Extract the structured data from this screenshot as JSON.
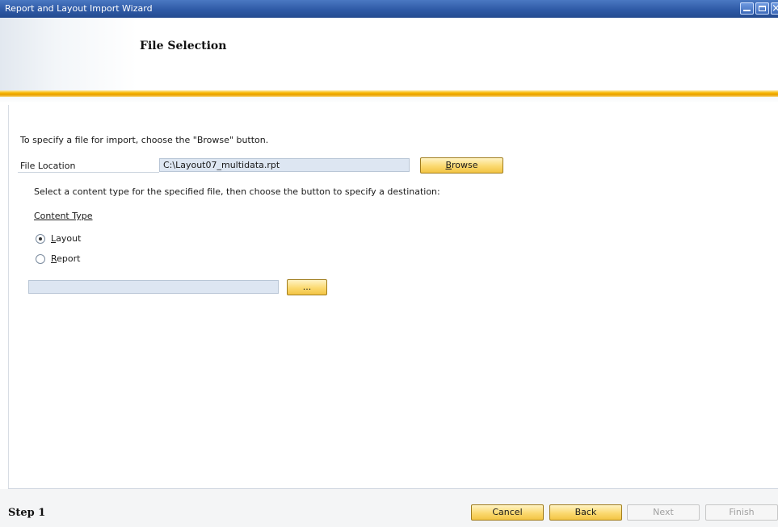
{
  "window": {
    "title": "Report and Layout Import Wizard"
  },
  "header": {
    "page_title": "File Selection"
  },
  "content": {
    "instruction": "To specify a file for import, choose the \"Browse\" button.",
    "file_location_label": "File Location",
    "file_location_value": "C:\\Layout07_multidata.rpt",
    "browse_accel": "B",
    "browse_rest": "rowse",
    "select_instruction": "Select a content type for the specified file, then choose the button to specify a destination:",
    "content_type_label": "Content Type",
    "options": [
      {
        "accel": "L",
        "rest": "ayout",
        "checked": true
      },
      {
        "accel": "R",
        "rest": "eport",
        "checked": false
      }
    ],
    "destination_value": "",
    "ellipsis_label": "..."
  },
  "footer": {
    "step": "Step 1",
    "cancel": "Cancel",
    "back": "Back",
    "next": "Next",
    "finish": "Finish"
  }
}
